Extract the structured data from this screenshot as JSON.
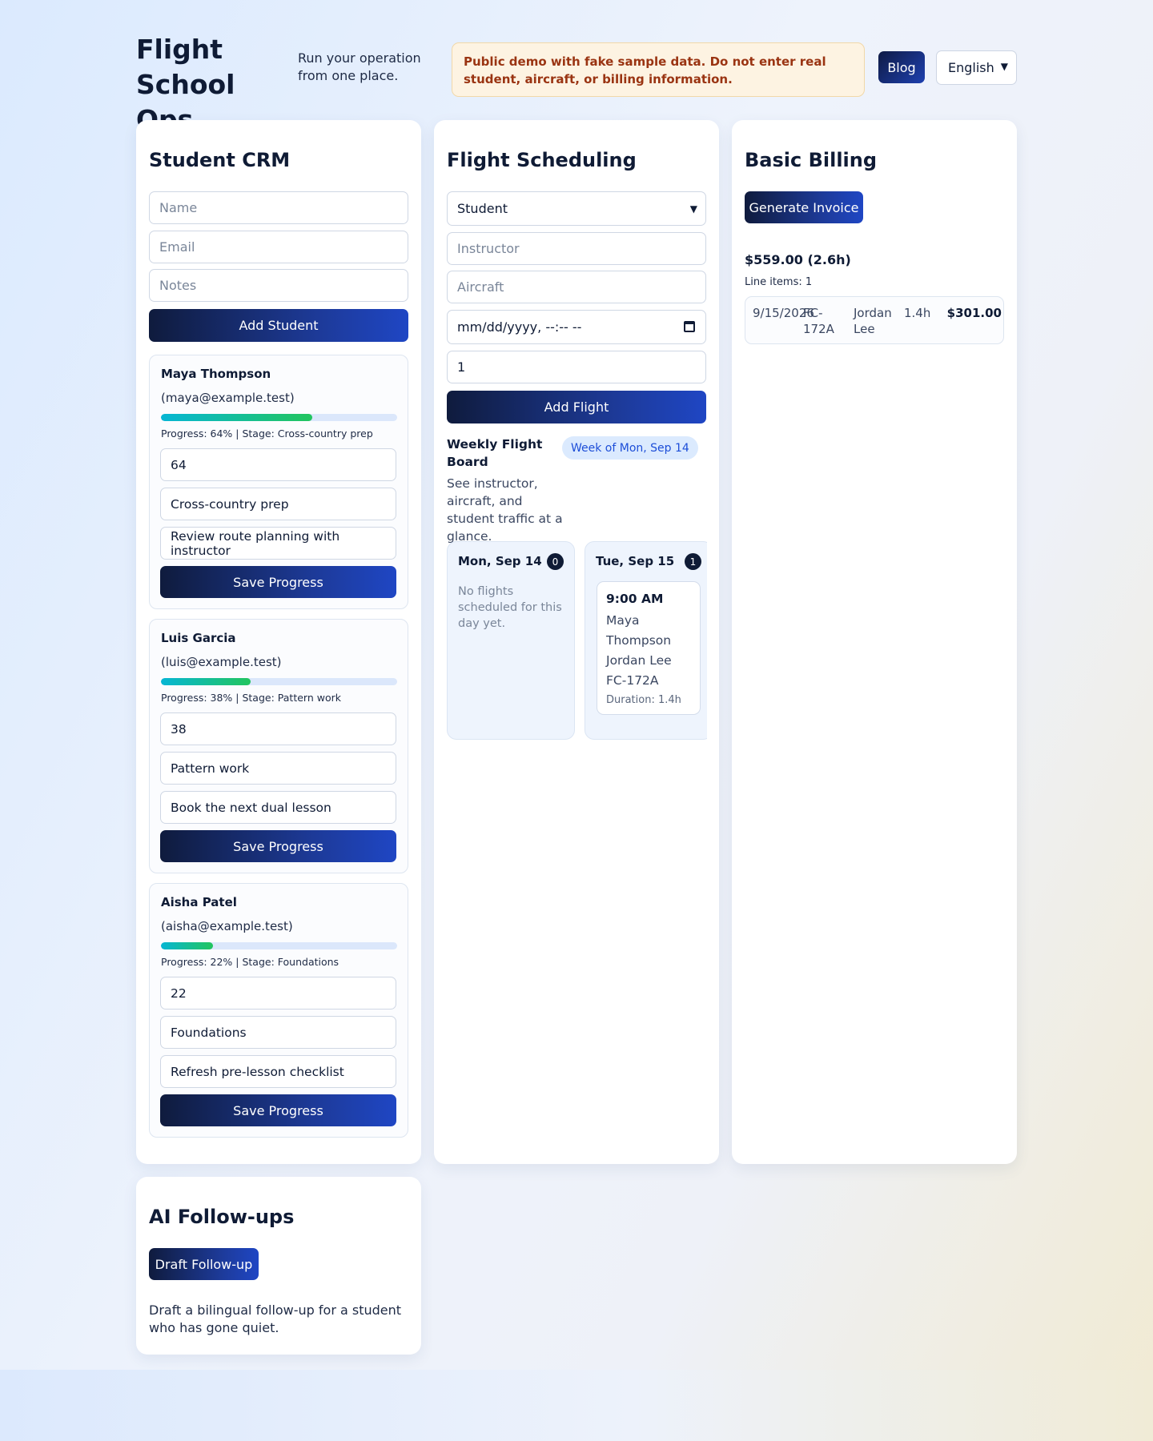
{
  "header": {
    "brand": "Flight School Ops",
    "tagline": "Run your operation from one place.",
    "notice": "Public demo with fake sample data. Do not enter real student, aircraft, or billing information.",
    "blog_label": "Blog",
    "language": "English"
  },
  "crm": {
    "title": "Student CRM",
    "name_placeholder": "Name",
    "email_placeholder": "Email",
    "notes_placeholder": "Notes",
    "add_label": "Add Student",
    "students": [
      {
        "name": "Maya Thompson",
        "email": "(maya@example.test)",
        "progress": 64,
        "meta": "Progress: 64% | Stage: Cross-country prep",
        "progress_value": "64",
        "stage_value": "Cross-country prep",
        "notes_value": "Review route planning with instructor",
        "save_label": "Save Progress"
      },
      {
        "name": "Luis Garcia",
        "email": "(luis@example.test)",
        "progress": 38,
        "meta": "Progress: 38% | Stage: Pattern work",
        "progress_value": "38",
        "stage_value": "Pattern work",
        "notes_value": "Book the next dual lesson",
        "save_label": "Save Progress"
      },
      {
        "name": "Aisha Patel",
        "email": "(aisha@example.test)",
        "progress": 22,
        "meta": "Progress: 22% | Stage: Foundations",
        "progress_value": "22",
        "stage_value": "Foundations",
        "notes_value": "Refresh pre-lesson checklist",
        "save_label": "Save Progress"
      }
    ]
  },
  "schedule": {
    "title": "Flight Scheduling",
    "student_select": "Student",
    "instructor_placeholder": "Instructor",
    "aircraft_placeholder": "Aircraft",
    "datetime_placeholder": "mm/dd/yyyy, --:-- --",
    "duration_value": "1",
    "add_label": "Add Flight",
    "board_title": "Weekly Flight Board",
    "week_label": "Week of Mon, Sep 14",
    "board_desc": "See instructor, aircraft, and student traffic at a glance.",
    "days": [
      {
        "name": "Mon, Sep 14",
        "count": "0",
        "empty": "No flights scheduled for this day yet."
      },
      {
        "name": "Tue, Sep 15",
        "count": "1",
        "flight": {
          "time": "9:00 AM",
          "student": "Maya Thompson",
          "instructor": "Jordan Lee",
          "aircraft": "FC-172A",
          "duration": "Duration: 1.4h"
        }
      }
    ]
  },
  "billing": {
    "title": "Basic Billing",
    "generate_label": "Generate Invoice",
    "total": "$559.00 (2.6h)",
    "line_items": "Line items: 1",
    "row": {
      "date": "9/15/2026",
      "aircraft": "FC-172A",
      "instructor": "Jordan Lee",
      "hours": "1.4h",
      "amount": "$301.00"
    }
  },
  "ai": {
    "title": "AI Follow-ups",
    "draft_label": "Draft Follow-up",
    "description": "Draft a bilingual follow-up for a student who has gone quiet."
  }
}
